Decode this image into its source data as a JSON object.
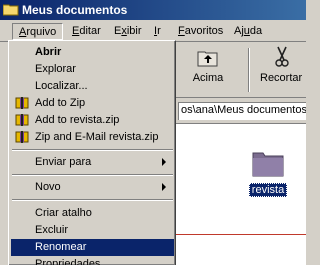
{
  "window": {
    "title": "Meus documentos"
  },
  "menubar": {
    "items": [
      {
        "label": "Arquivo",
        "underline": "A",
        "rest": "rquivo",
        "active": true
      },
      {
        "label": "Editar",
        "underline": "E",
        "rest": "ditar"
      },
      {
        "label": "Exibir",
        "underline": "x",
        "pre": "E",
        "rest": "ibir"
      },
      {
        "label": "Ir",
        "underline": "I",
        "rest": "r"
      },
      {
        "label": "Favoritos",
        "underline": "F",
        "rest": "avoritos"
      },
      {
        "label": "Ajuda",
        "pre": "Aj",
        "underline": "u",
        "rest": "da"
      }
    ]
  },
  "toolbar": {
    "up_label": "Acima",
    "cut_label": "Recortar"
  },
  "address": {
    "value": "os\\ana\\Meus documentos"
  },
  "content": {
    "file_name": "revista"
  },
  "file_menu": {
    "items": [
      {
        "label": "Abrir",
        "bold": true
      },
      {
        "label": "Explorar"
      },
      {
        "label": "Localizar..."
      },
      {
        "label": "Add to Zip",
        "icon": "winzip-icon"
      },
      {
        "label": "Add to revista.zip",
        "icon": "winzip-icon"
      },
      {
        "label": "Zip and E-Mail revista.zip",
        "icon": "winzip-icon"
      },
      {
        "label": "Enviar para",
        "submenu": true
      },
      {
        "label": "Novo",
        "submenu": true
      },
      {
        "label": "Criar atalho"
      },
      {
        "label": "Excluir"
      },
      {
        "label": "Renomear",
        "selected": true
      },
      {
        "label": "Propriedades"
      }
    ]
  },
  "colors": {
    "title_bar": "#0a246a",
    "selection": "#0a246a",
    "face": "#d4d0c8"
  }
}
